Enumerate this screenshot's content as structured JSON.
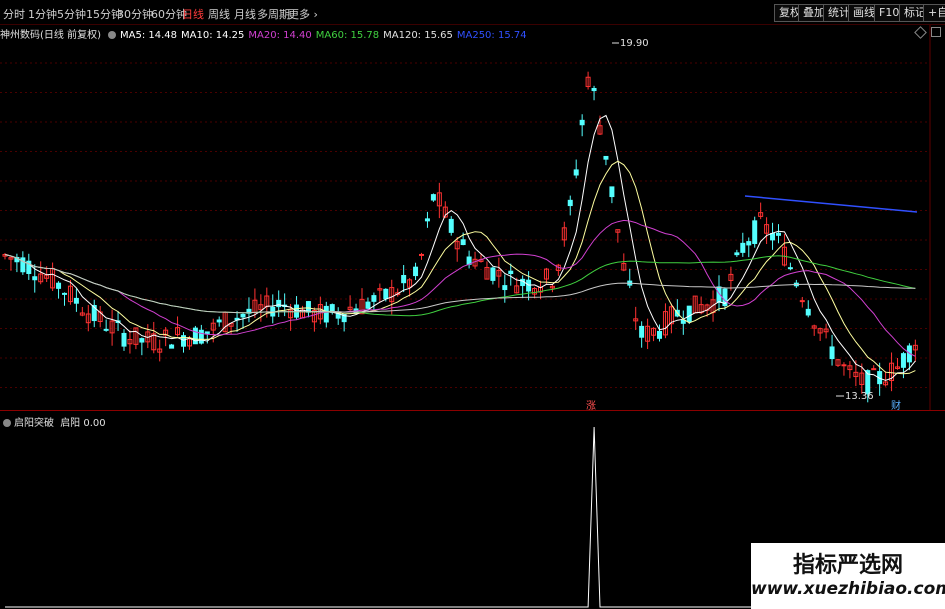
{
  "toolbar": {
    "periods": [
      "分时",
      "1分钟",
      "5分钟",
      "15分钟",
      "30分钟",
      "60分钟",
      "日线",
      "周线",
      "月线",
      "多周期",
      "更多"
    ],
    "active_period": "日线",
    "buttons": [
      "复权",
      "叠加",
      "统计",
      "画线",
      "F10",
      "标记",
      "+自选"
    ]
  },
  "main_chart": {
    "title": "神州数码(日线 前复权)",
    "ma_labels": [
      {
        "text": "MA5: 14.48",
        "color": "#ffffff"
      },
      {
        "text": "MA10: 14.25",
        "color": "#ffffff"
      },
      {
        "text": "MA20: 14.40",
        "color": "#d040d0"
      },
      {
        "text": "MA60: 15.78",
        "color": "#40d040"
      },
      {
        "text": "MA120: 15.65",
        "color": "#e0e0e0"
      },
      {
        "text": "MA250: 15.74",
        "color": "#3050ff"
      }
    ],
    "high_label": "19.90",
    "low_label": "13.36",
    "marker_zhang": "涨",
    "marker_cai": "财",
    "up_color": "#ff3232",
    "down_color": "#54ffff"
  },
  "indicator": {
    "name": "启阳突破",
    "series_name": "启阳",
    "value": "0.00",
    "signal_values": [
      0,
      0,
      0,
      0,
      0,
      0,
      0,
      0,
      0,
      0,
      0,
      0,
      0,
      0,
      0,
      0,
      0,
      0,
      0,
      0,
      0,
      0,
      0,
      0,
      0,
      0,
      0,
      0,
      0,
      0,
      0,
      0,
      0,
      0,
      0,
      0,
      0,
      0,
      0,
      0,
      0,
      0,
      0,
      0,
      0,
      0,
      0,
      0,
      0,
      0,
      0,
      0,
      0,
      0,
      0,
      0,
      0,
      0,
      0,
      0,
      0,
      0,
      0,
      0,
      0,
      0,
      0,
      0,
      0,
      0,
      0,
      0,
      0,
      0,
      0,
      0,
      0,
      0,
      0,
      0,
      0,
      0,
      0,
      0,
      0,
      0,
      0,
      0,
      0,
      0,
      0,
      0,
      0,
      0,
      0,
      0,
      0,
      0,
      0,
      1,
      0,
      0,
      0,
      0,
      0,
      0,
      0,
      0,
      0,
      0,
      0,
      0,
      0,
      0,
      0,
      0,
      0,
      0,
      0,
      0,
      0,
      0,
      0,
      0,
      0,
      0,
      0,
      0,
      0,
      0,
      0,
      0,
      0,
      0,
      0,
      0,
      0,
      0,
      0,
      0,
      0,
      0,
      0,
      0,
      0,
      0,
      0,
      0,
      0,
      0,
      0,
      0,
      0,
      0
    ]
  },
  "watermark": {
    "title": "指标严选网",
    "url": "www.xuezhibiao.com"
  }
}
